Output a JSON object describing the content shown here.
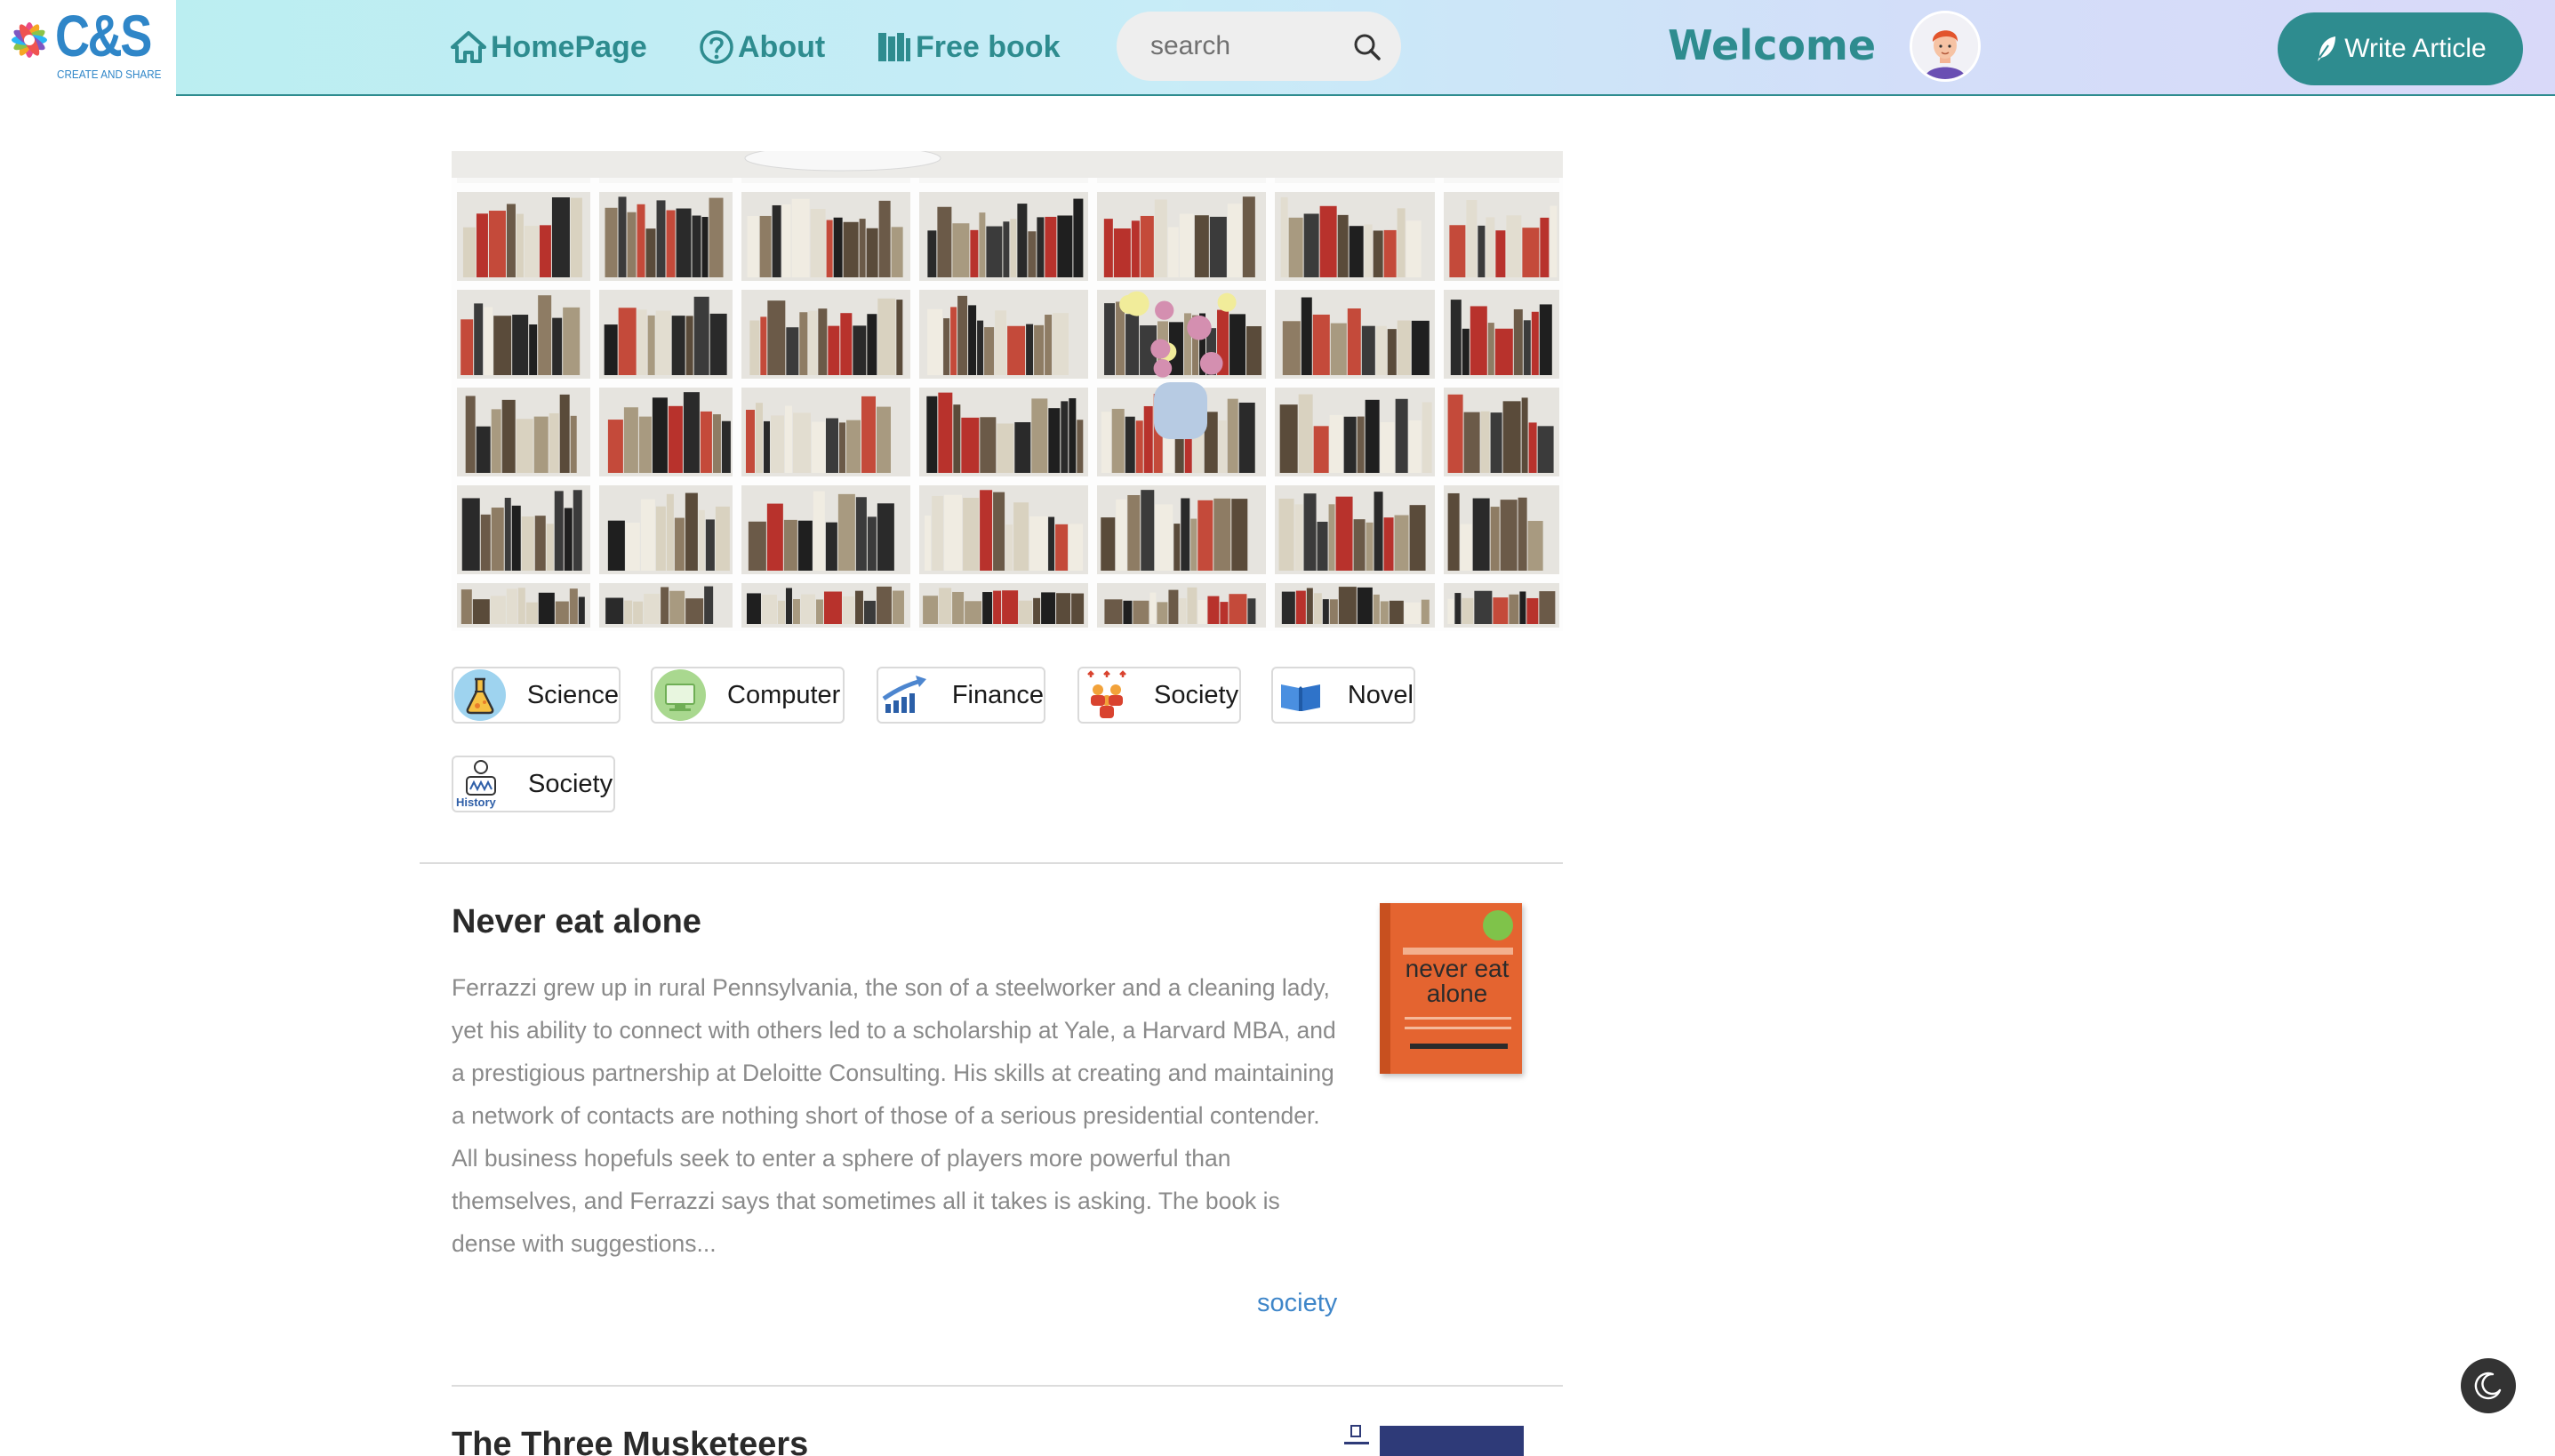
{
  "brand": {
    "logo_text": "C&S",
    "logo_sub": "CREATE AND SHARE"
  },
  "nav": {
    "home": "HomePage",
    "about": "About",
    "free_book": "Free book"
  },
  "search": {
    "placeholder": "search",
    "value": ""
  },
  "header": {
    "welcome": "Welcome",
    "write_article": "Write Article"
  },
  "categories": [
    {
      "label": "Science",
      "icon": "flask-icon"
    },
    {
      "label": "Computer",
      "icon": "computer-icon"
    },
    {
      "label": "Finance",
      "icon": "chart-growth-icon"
    },
    {
      "label": "Society",
      "icon": "people-icon"
    },
    {
      "label": "Novel",
      "icon": "open-book-icon"
    },
    {
      "label": "Society",
      "icon": "history-icon",
      "icon_text": "History"
    }
  ],
  "articles": [
    {
      "title": "Never eat alone",
      "summary": "Ferrazzi grew up in rural Pennsylvania, the son of a steelworker and a cleaning lady, yet his ability to connect with others led to a scholarship at Yale, a Harvard MBA, and a prestigious partnership at Deloitte Consulting. His skills at creating and maintaining a network of contacts are nothing short of those of a serious presidential contender. All business hopefuls seek to enter a sphere of players more powerful than themselves, and Ferrazzi says that sometimes all it takes is asking. The book is dense with suggestions...",
      "tag": "society",
      "cover_title": "never eat alone"
    },
    {
      "title": "The Three Musketeers"
    }
  ],
  "colors": {
    "accent": "#2e8c8f",
    "link": "#3f86c9",
    "body_text": "#8a8a8a",
    "toggle_bg": "#333333"
  }
}
